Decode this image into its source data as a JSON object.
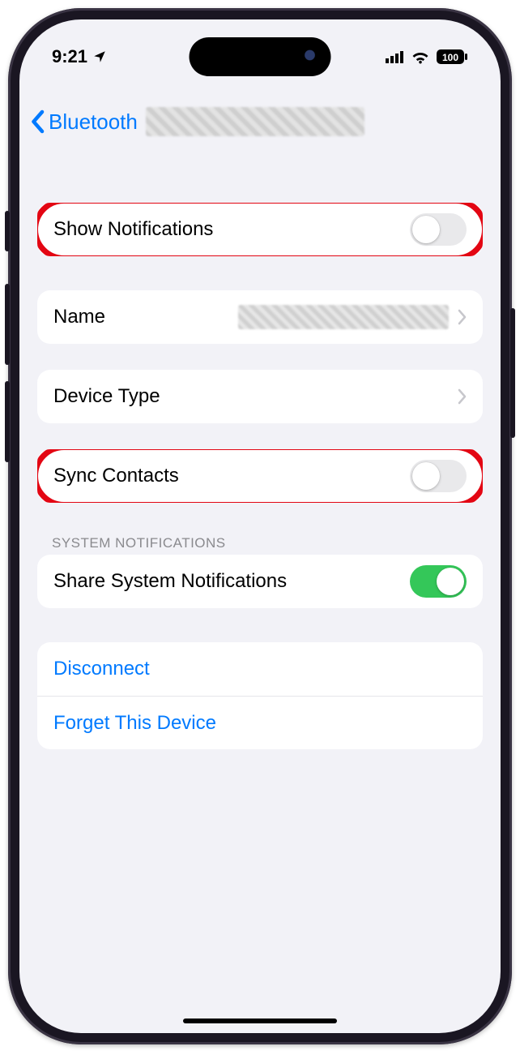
{
  "status": {
    "time": "9:21",
    "battery": "100"
  },
  "nav": {
    "back": "Bluetooth"
  },
  "rows": {
    "showNotifications": {
      "label": "Show Notifications",
      "on": false
    },
    "name": {
      "label": "Name"
    },
    "deviceType": {
      "label": "Device Type"
    },
    "syncContacts": {
      "label": "Sync Contacts",
      "on": false
    },
    "sectionHeader": "SYSTEM NOTIFICATIONS",
    "shareSystem": {
      "label": "Share System Notifications",
      "on": true
    },
    "disconnect": {
      "label": "Disconnect"
    },
    "forget": {
      "label": "Forget This Device"
    }
  }
}
